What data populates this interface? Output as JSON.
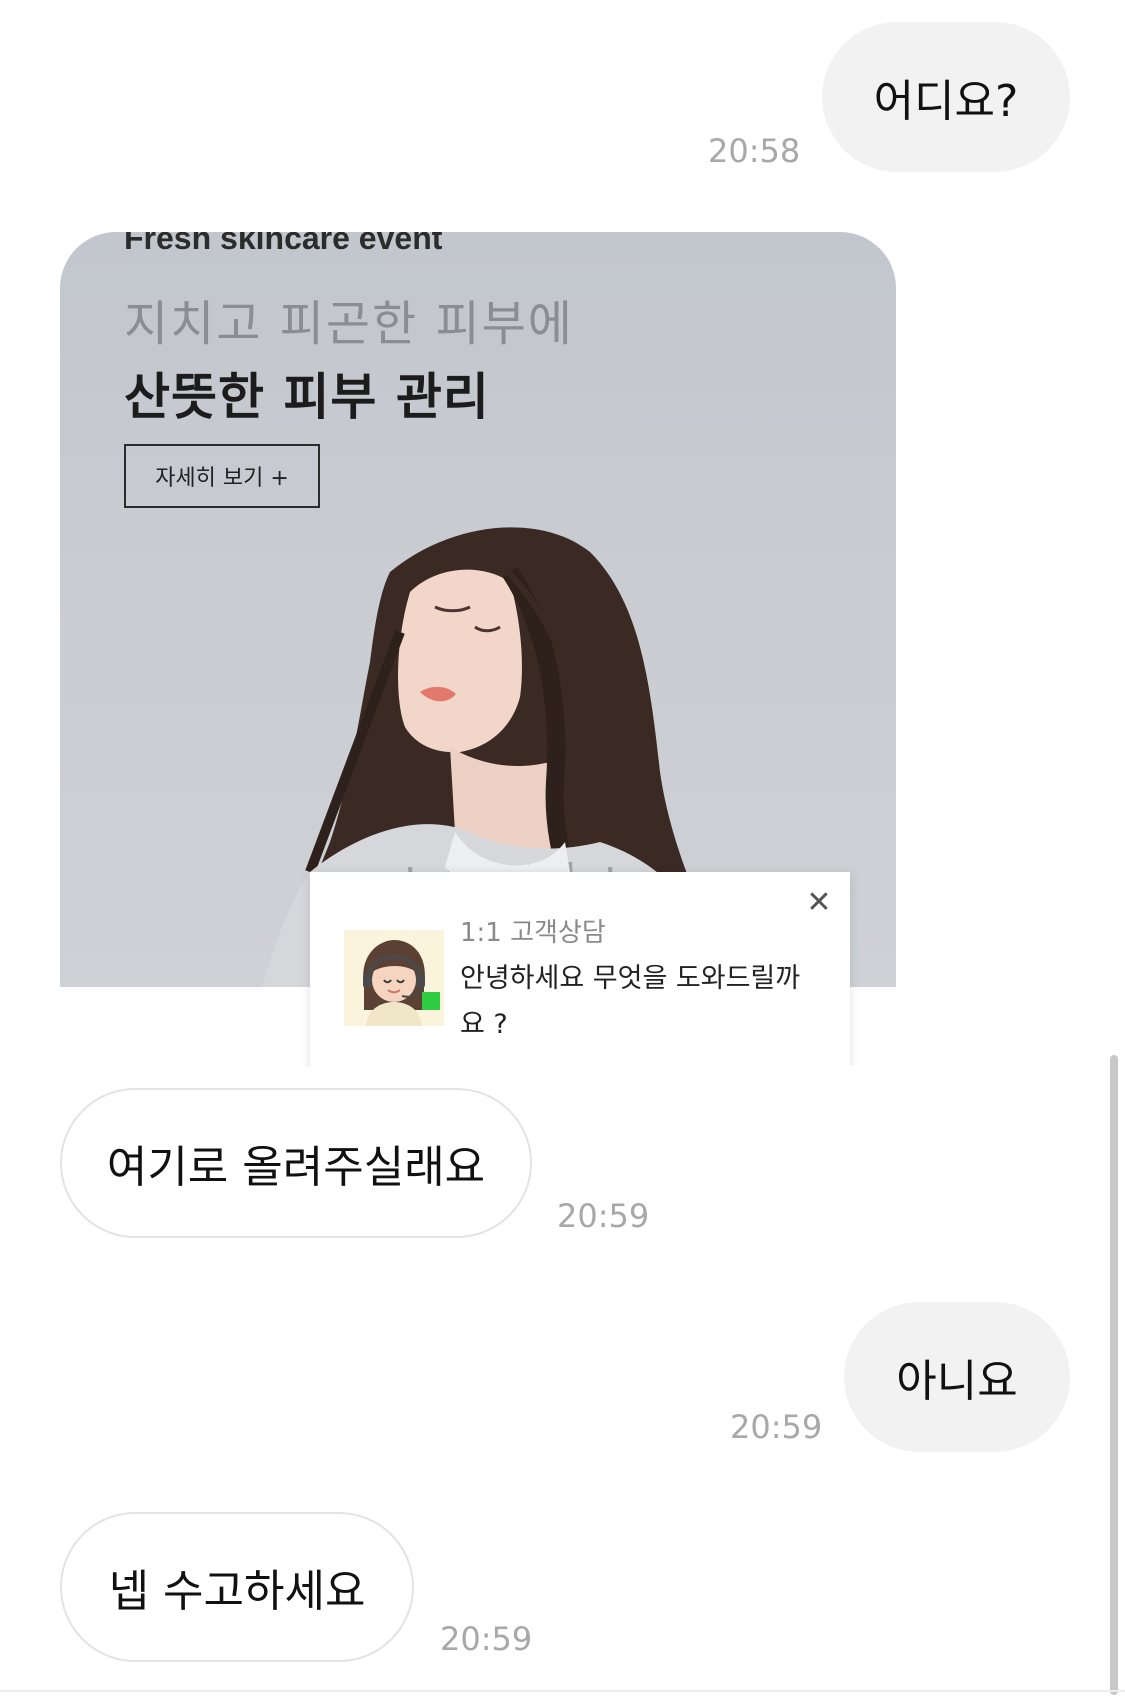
{
  "messages": {
    "m1": {
      "text": "어디요?",
      "time": "20:58"
    },
    "m2": {
      "time": ""
    },
    "m3": {
      "text": "여기로 올려주실래요",
      "time": "20:59"
    },
    "m4": {
      "text": "아니요",
      "time": "20:59"
    },
    "m5": {
      "text": "넵 수고하세요",
      "time": "20:59"
    }
  },
  "image": {
    "event_tag": "Fresh skincare event",
    "headline1": "지치고 피곤한 피부에",
    "headline2": "산뜻한 피부 관리",
    "detail_button": "자세히 보기 +",
    "widget": {
      "title": "1:1 고객상담",
      "message": "안녕하세요 무엇을 도와드릴까요 ?",
      "close_icon": "close-icon",
      "avatar_icon": "agent-avatar-icon",
      "status_color": "#2ecc40"
    }
  }
}
